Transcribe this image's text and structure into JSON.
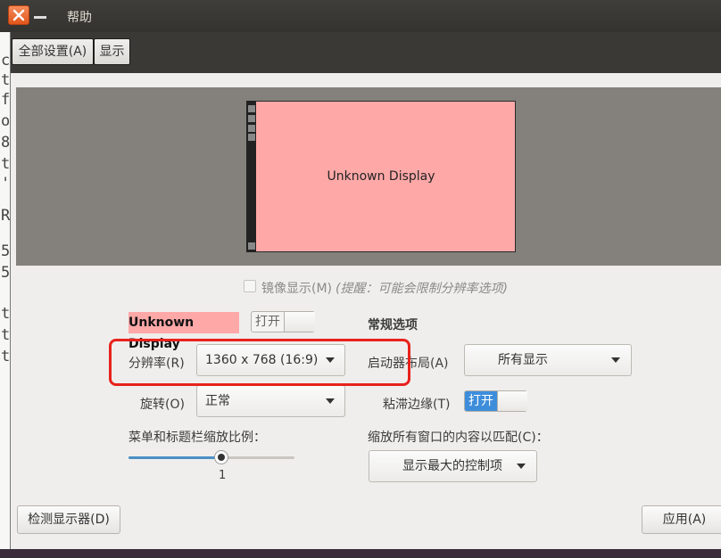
{
  "window": {
    "title": "帮助"
  },
  "background_terminal": {
    "chars": [
      "c",
      "t",
      "f",
      "o",
      "8",
      "t",
      "'",
      "R",
      "5",
      "5",
      "t",
      "t",
      "t"
    ]
  },
  "toolbar": {
    "all_settings": "全部设置(A)",
    "display": "显示"
  },
  "preview": {
    "monitor_label": "Unknown Display"
  },
  "mirror": {
    "label": "镜像显示(M)",
    "hint": "(提醒：可能会限制分辨率选项)",
    "checked": false
  },
  "display": {
    "name": "Unknown Display",
    "power_label": "打开",
    "resolution_label": "分辨率(R)",
    "resolution_value": "1360 x 768 (16:9)",
    "rotation_label": "旋转(O)",
    "rotation_value": "正常",
    "scale_label": "菜单和标题栏缩放比例：",
    "scale_value": "1",
    "scale_fraction": 0.56
  },
  "general": {
    "heading": "常规选项",
    "launcher_label": "启动器布局(A)",
    "launcher_value": "所有显示",
    "sticky_label": "粘滞边缘(T)",
    "sticky_value": "打开",
    "fit_label": "缩放所有窗口的内容以匹配(C)：",
    "fit_value": "显示最大的控制项"
  },
  "buttons": {
    "detect": "检测显示器(D)",
    "apply": "应用(A)"
  },
  "colors": {
    "monitor": "#ffa8a8",
    "highlight": "#e8221c",
    "toggle_on": "#3d8ddb",
    "close": "#e8601e"
  }
}
